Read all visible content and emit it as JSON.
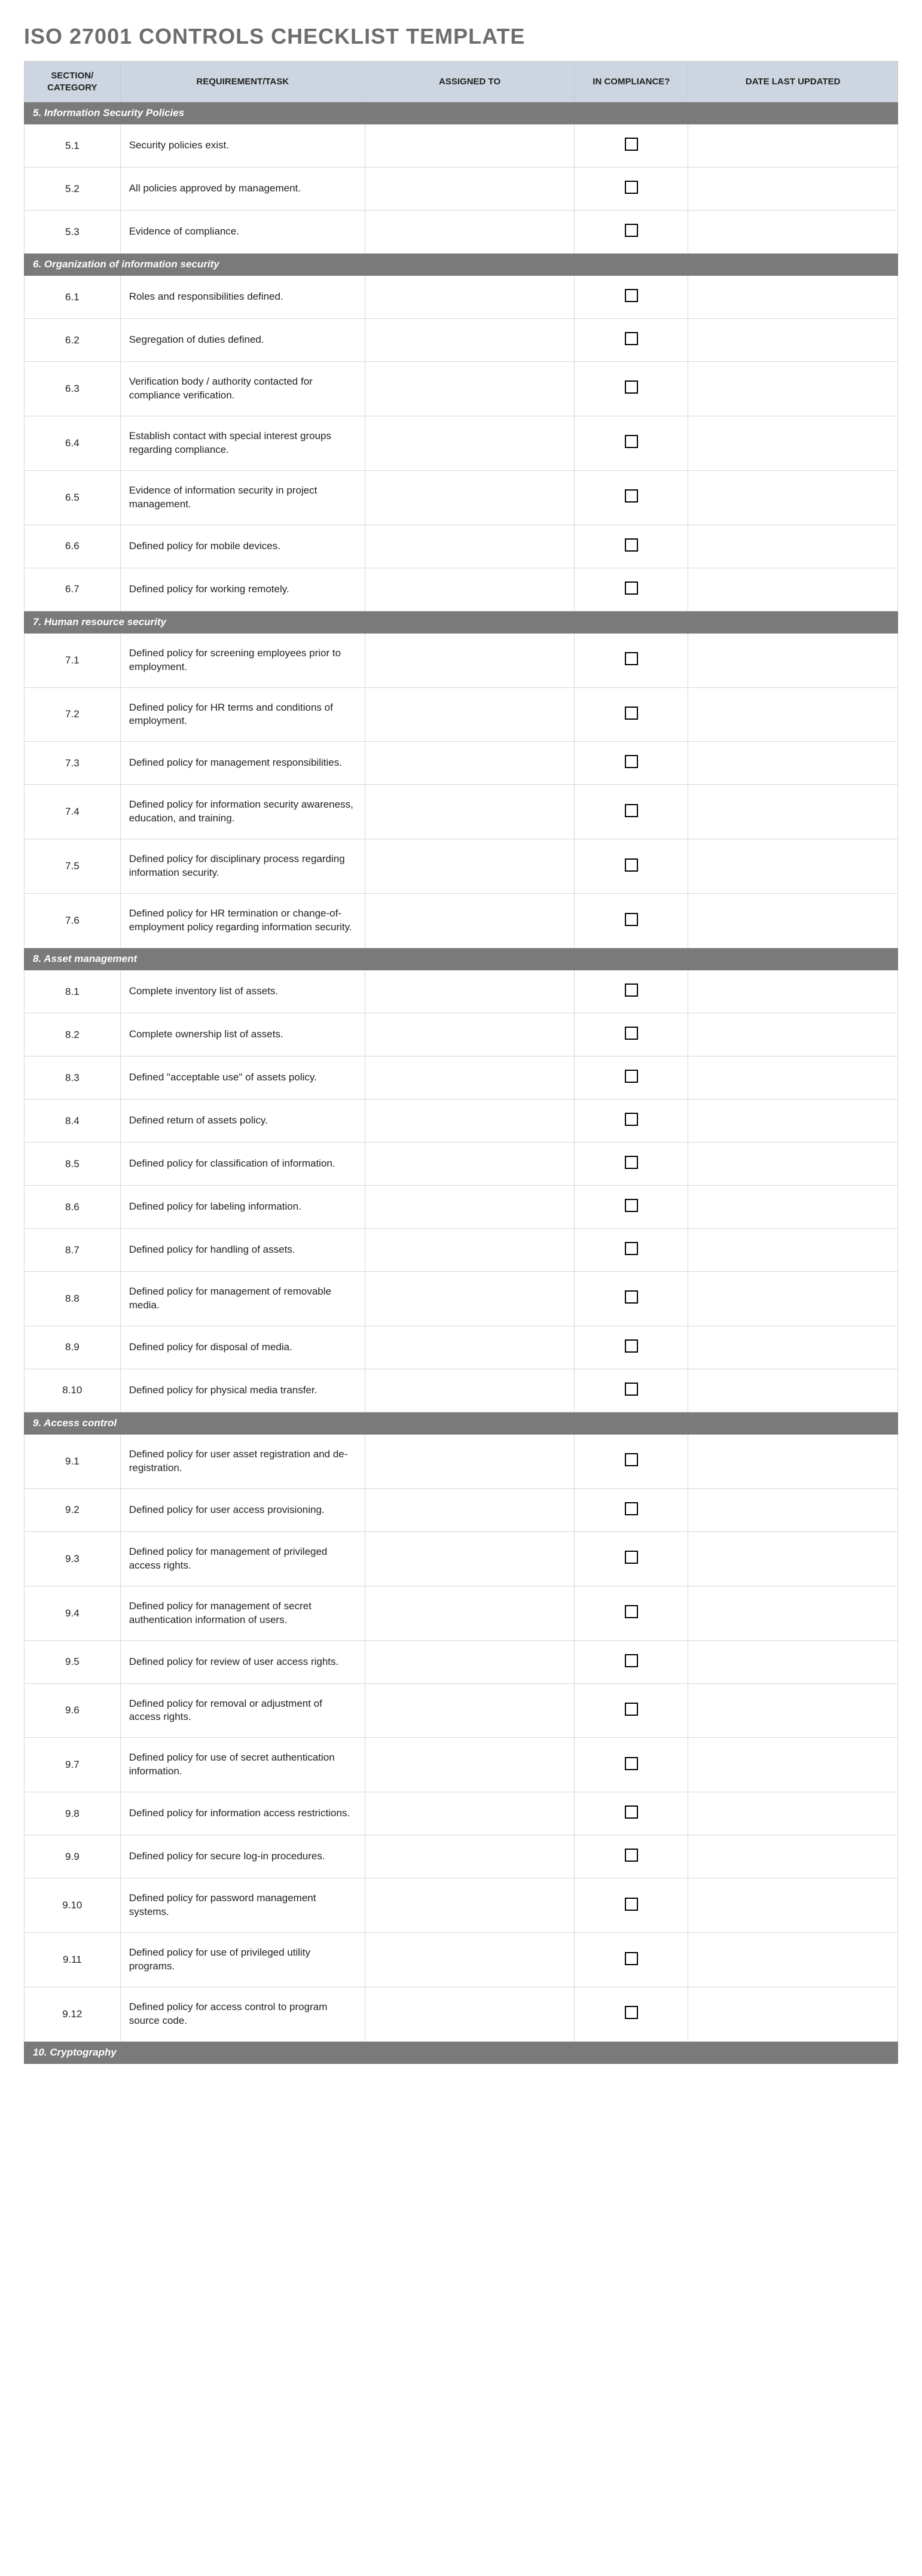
{
  "title": "ISO 27001 CONTROLS CHECKLIST TEMPLATE",
  "headers": {
    "section": "SECTION/ CATEGORY",
    "task": "REQUIREMENT/TASK",
    "assigned": "ASSIGNED TO",
    "compliance": "IN COMPLIANCE?",
    "updated": "DATE LAST UPDATED"
  },
  "sections": [
    {
      "title": "5. Information Security Policies",
      "rows": [
        {
          "num": "5.1",
          "task": "Security policies exist.",
          "assigned": "",
          "checked": false,
          "updated": ""
        },
        {
          "num": "5.2",
          "task": "All policies approved by management.",
          "assigned": "",
          "checked": false,
          "updated": ""
        },
        {
          "num": "5.3",
          "task": "Evidence of compliance.",
          "assigned": "",
          "checked": false,
          "updated": ""
        }
      ]
    },
    {
      "title": "6. Organization of information security",
      "rows": [
        {
          "num": "6.1",
          "task": "Roles and responsibilities defined.",
          "assigned": "",
          "checked": false,
          "updated": ""
        },
        {
          "num": "6.2",
          "task": "Segregation of duties defined.",
          "assigned": "",
          "checked": false,
          "updated": ""
        },
        {
          "num": "6.3",
          "task": "Verification body / authority contacted for compliance verification.",
          "assigned": "",
          "checked": false,
          "updated": ""
        },
        {
          "num": "6.4",
          "task": "Establish contact with special interest groups regarding compliance.",
          "assigned": "",
          "checked": false,
          "updated": ""
        },
        {
          "num": "6.5",
          "task": "Evidence of information security in project management.",
          "assigned": "",
          "checked": false,
          "updated": ""
        },
        {
          "num": "6.6",
          "task": "Defined policy for mobile devices.",
          "assigned": "",
          "checked": false,
          "updated": ""
        },
        {
          "num": "6.7",
          "task": "Defined policy for working remotely.",
          "assigned": "",
          "checked": false,
          "updated": ""
        }
      ]
    },
    {
      "title": "7. Human resource security",
      "rows": [
        {
          "num": "7.1",
          "task": "Defined policy for screening employees prior to employment.",
          "assigned": "",
          "checked": false,
          "updated": ""
        },
        {
          "num": "7.2",
          "task": "Defined policy for HR terms and conditions of employment.",
          "assigned": "",
          "checked": false,
          "updated": ""
        },
        {
          "num": "7.3",
          "task": "Defined policy for management responsibilities.",
          "assigned": "",
          "checked": false,
          "updated": ""
        },
        {
          "num": "7.4",
          "task": "Defined policy for information security awareness, education, and training.",
          "assigned": "",
          "checked": false,
          "updated": ""
        },
        {
          "num": "7.5",
          "task": "Defined policy for disciplinary process regarding information security.",
          "assigned": "",
          "checked": false,
          "updated": ""
        },
        {
          "num": "7.6",
          "task": "Defined policy for HR termination or change-of-employment policy regarding information security.",
          "assigned": "",
          "checked": false,
          "updated": ""
        }
      ]
    },
    {
      "title": "8. Asset management",
      "rows": [
        {
          "num": "8.1",
          "task": "Complete inventory list of assets.",
          "assigned": "",
          "checked": false,
          "updated": ""
        },
        {
          "num": "8.2",
          "task": "Complete ownership list of assets.",
          "assigned": "",
          "checked": false,
          "updated": ""
        },
        {
          "num": "8.3",
          "task": "Defined \"acceptable use\" of assets policy.",
          "assigned": "",
          "checked": false,
          "updated": ""
        },
        {
          "num": "8.4",
          "task": "Defined return of assets policy.",
          "assigned": "",
          "checked": false,
          "updated": ""
        },
        {
          "num": "8.5",
          "task": "Defined policy for classification of information.",
          "assigned": "",
          "checked": false,
          "updated": ""
        },
        {
          "num": "8.6",
          "task": "Defined policy for labeling information.",
          "assigned": "",
          "checked": false,
          "updated": ""
        },
        {
          "num": "8.7",
          "task": "Defined policy for handling of assets.",
          "assigned": "",
          "checked": false,
          "updated": ""
        },
        {
          "num": "8.8",
          "task": "Defined policy for management of removable media.",
          "assigned": "",
          "checked": false,
          "updated": ""
        },
        {
          "num": "8.9",
          "task": "Defined policy for disposal of media.",
          "assigned": "",
          "checked": false,
          "updated": ""
        },
        {
          "num": "8.10",
          "task": "Defined policy for physical media transfer.",
          "assigned": "",
          "checked": false,
          "updated": ""
        }
      ]
    },
    {
      "title": "9. Access control",
      "rows": [
        {
          "num": "9.1",
          "task": "Defined policy for user asset registration and de-registration.",
          "assigned": "",
          "checked": false,
          "updated": ""
        },
        {
          "num": "9.2",
          "task": "Defined policy for user access provisioning.",
          "assigned": "",
          "checked": false,
          "updated": ""
        },
        {
          "num": "9.3",
          "task": "Defined policy for management of privileged access rights.",
          "assigned": "",
          "checked": false,
          "updated": ""
        },
        {
          "num": "9.4",
          "task": "Defined policy for management of secret authentication information of users.",
          "assigned": "",
          "checked": false,
          "updated": ""
        },
        {
          "num": "9.5",
          "task": "Defined policy for review of user access rights.",
          "assigned": "",
          "checked": false,
          "updated": ""
        },
        {
          "num": "9.6",
          "task": "Defined policy for removal or adjustment of access rights.",
          "assigned": "",
          "checked": false,
          "updated": ""
        },
        {
          "num": "9.7",
          "task": "Defined policy for use of secret authentication information.",
          "assigned": "",
          "checked": false,
          "updated": ""
        },
        {
          "num": "9.8",
          "task": "Defined policy for information access restrictions.",
          "assigned": "",
          "checked": false,
          "updated": ""
        },
        {
          "num": "9.9",
          "task": "Defined policy for secure log-in procedures.",
          "assigned": "",
          "checked": false,
          "updated": ""
        },
        {
          "num": "9.10",
          "task": "Defined policy for password management systems.",
          "assigned": "",
          "checked": false,
          "updated": ""
        },
        {
          "num": "9.11",
          "task": "Defined policy for use of privileged utility programs.",
          "assigned": "",
          "checked": false,
          "updated": ""
        },
        {
          "num": "9.12",
          "task": "Defined policy for access control to program source code.",
          "assigned": "",
          "checked": false,
          "updated": ""
        }
      ]
    },
    {
      "title": "10. Cryptography",
      "rows": []
    }
  ]
}
